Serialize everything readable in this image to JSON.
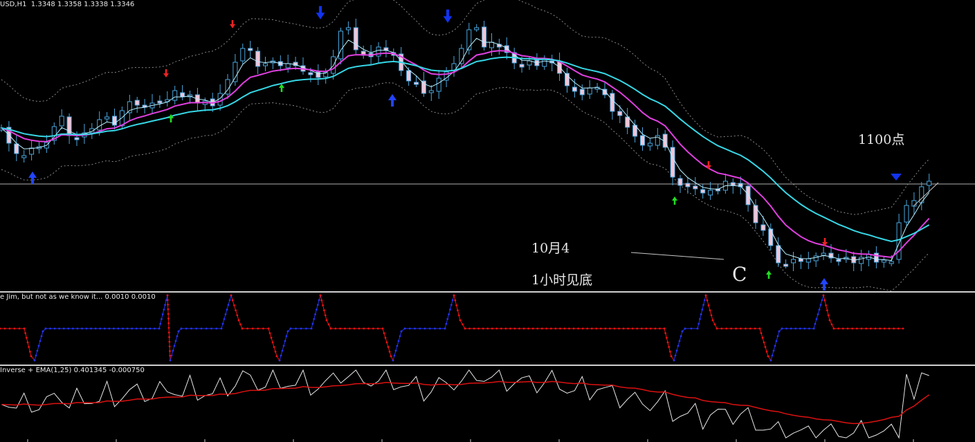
{
  "chart_header": {
    "symbol_timeframe": "USD,H1",
    "ohlc": "1.3348 1.3358 1.3338 1.3346"
  },
  "annotations": {
    "points_label": "1100点",
    "date_label": "10月4",
    "bottom_label": "1小时见底",
    "wave_label": "C"
  },
  "indicator1": {
    "header": "e Jim, but not as we know it... 0.0010 0.0010"
  },
  "indicator2": {
    "header": "Inverse + EMA(1,25) 0.401345 -0.000750"
  },
  "colors": {
    "background": "#000000",
    "bull_candle": "#000000",
    "bear_candle": "#f2c6d8",
    "candle_outline": "#4aa8e0",
    "ma_cyan": "#37d7e6",
    "ma_magenta": "#e040e0",
    "ma_thin": "#b8f0ff",
    "band": "#8a8a8a",
    "arrow_up_green": "#22dd22",
    "arrow_up_blue": "#2244ff",
    "arrow_down_red": "#ee2222",
    "arrow_down_blue": "#1133ee",
    "ind1_red": "#ee1111",
    "ind1_blue": "#2233ee",
    "ind2_white": "#e8e8e8",
    "ind2_red": "#dd1111"
  },
  "chart_data": [
    {
      "type": "line",
      "name": "price-chart",
      "series": [
        {
          "name": "Close",
          "values": [
            185,
            207,
            222,
            225,
            214,
            212,
            206,
            183,
            168,
            196,
            200,
            192,
            186,
            173,
            169,
            181,
            160,
            147,
            152,
            154,
            149,
            148,
            144,
            131,
            140,
            137,
            149,
            146,
            153,
            135,
            115,
            90,
            70,
            72,
            96,
            92,
            88,
            95,
            92,
            95,
            103,
            107,
            112,
            105,
            82,
            45,
            40,
            72,
            80,
            82,
            68,
            73,
            80,
            102,
            117,
            120,
            135,
            131,
            113,
            104,
            92,
            70,
            43,
            40,
            68,
            61,
            68,
            76,
            91,
            97,
            88,
            95,
            85,
            91,
            106,
            124,
            132,
            137,
            127,
            126,
            137,
            161,
            167,
            184,
            197,
            210,
            207,
            196,
            213,
            256,
            268,
            270,
            273,
            279,
            275,
            275,
            262,
            268,
            270,
            296,
            322,
            333,
            355,
            380,
            383,
            375,
            378,
            374,
            370,
            366,
            373,
            378,
            372,
            380,
            372,
            368,
            379,
            376,
            378,
            322,
            297,
            290,
            270,
            262
          ]
        }
      ],
      "ylim": [
        430,
        0
      ]
    }
  ]
}
